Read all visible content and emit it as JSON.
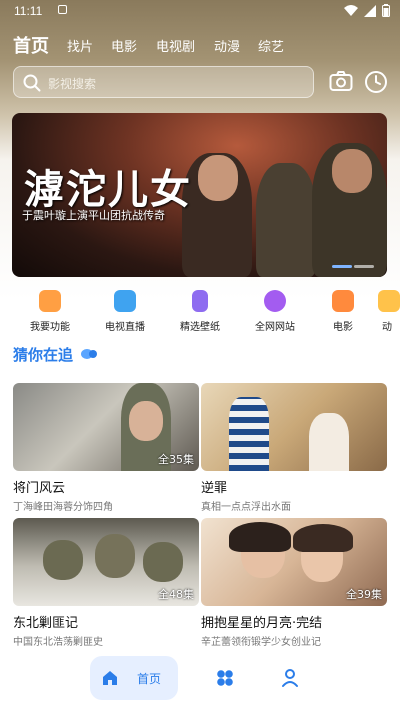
{
  "status": {
    "time": "11:11"
  },
  "nav": {
    "tabs": [
      "首页",
      "找片",
      "电影",
      "电视剧",
      "动漫",
      "综艺"
    ]
  },
  "search": {
    "placeholder": "影视搜索"
  },
  "banner": {
    "title_art": "滹沱儿女",
    "subtitle": "于震叶璇上演平山团抗战传奇"
  },
  "features": [
    "我要功能",
    "电视直播",
    "精选壁纸",
    "全网网站",
    "电影",
    "动"
  ],
  "section": {
    "title": "猜你在追"
  },
  "cards": [
    {
      "title": "将门风云",
      "desc": "丁海峰田海蓉分饰四角",
      "episodes": "全35集"
    },
    {
      "title": "逆罪",
      "desc": "真相一点点浮出水面",
      "episodes": ""
    },
    {
      "title": "东北剿匪记",
      "desc": "中国东北浩荡剿匪史",
      "episodes": "全48集"
    },
    {
      "title": "拥抱星星的月亮·完结",
      "desc": "辛芷蕾领衔锻学少女创业记",
      "episodes": "全39集"
    }
  ],
  "bottom": {
    "home_label": "首页"
  },
  "colors": {
    "accent": "#2b7de9"
  }
}
